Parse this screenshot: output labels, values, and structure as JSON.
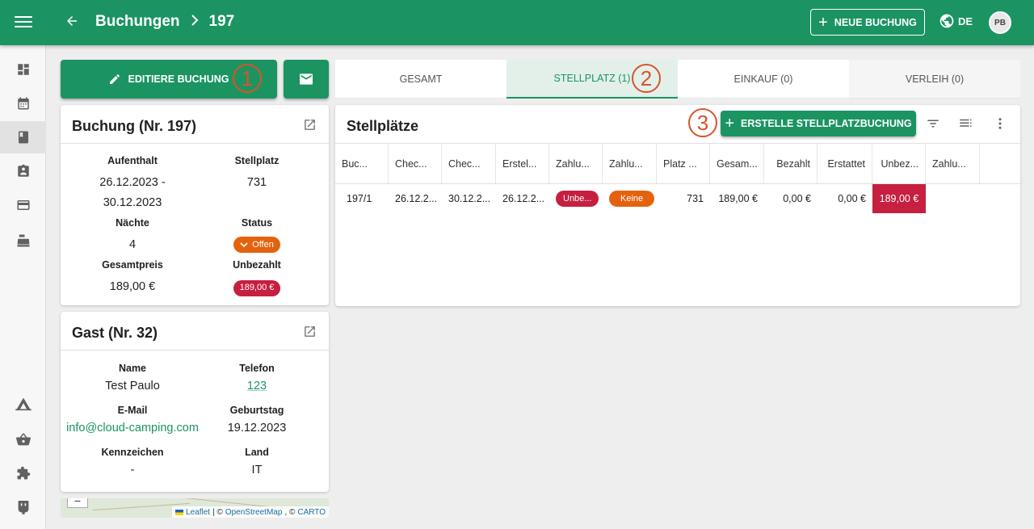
{
  "header": {
    "breadcrumb_parent": "Buchungen",
    "breadcrumb_current": "197",
    "new_booking_label": "NEUE BUCHUNG",
    "language": "DE",
    "avatar_initials": "PB"
  },
  "sidebar": {
    "items": [
      {
        "icon": "dashboard-icon"
      },
      {
        "icon": "calendar-icon"
      },
      {
        "icon": "book-icon",
        "active": true
      },
      {
        "icon": "contact-card-icon"
      },
      {
        "icon": "credit-card-icon"
      },
      {
        "icon": "cash-register-icon"
      },
      {
        "icon": "tent-icon"
      },
      {
        "icon": "basket-icon"
      },
      {
        "icon": "puzzle-icon"
      },
      {
        "icon": "plug-icon"
      }
    ]
  },
  "actions": {
    "edit_label": "EDITIERE BUCHUNG",
    "marker_1": "1",
    "marker_2": "2",
    "marker_3": "3"
  },
  "booking_card": {
    "title": "Buchung (Nr. 197)",
    "stay_label": "Aufenthalt",
    "stay_value_line1": "26.12.2023 -",
    "stay_value_line2": "30.12.2023",
    "pitch_label": "Stellplatz",
    "pitch_value": "731",
    "nights_label": "Nächte",
    "nights_value": "4",
    "status_label": "Status",
    "status_value": "Offen",
    "total_label": "Gesamtpreis",
    "total_value": "189,00 €",
    "unpaid_label": "Unbezahlt",
    "unpaid_value": "189,00 €"
  },
  "guest_card": {
    "title": "Gast (Nr. 32)",
    "name_label": "Name",
    "name_value": "Test Paulo",
    "phone_label": "Telefon",
    "phone_value": "123",
    "email_label": "E-Mail",
    "email_value": "info@cloud-camping.com",
    "birthday_label": "Geburtstag",
    "birthday_value": "19.12.2023",
    "plate_label": "Kennzeichen",
    "plate_value": "-",
    "country_label": "Land",
    "country_value": "IT"
  },
  "map": {
    "zoom_out": "−",
    "attr_leaflet": "Leaflet",
    "attr_sep1": "| ©",
    "attr_osm": "OpenStreetMap",
    "attr_sep2": ", ©",
    "attr_carto": "CARTO"
  },
  "tabs": [
    {
      "label": "GESAMT"
    },
    {
      "label": "STELLPLATZ (1)",
      "active": true
    },
    {
      "label": "EINKAUF (0)"
    },
    {
      "label": "VERLEIH (0)"
    }
  ],
  "pitches": {
    "title": "Stellplätze",
    "create_label": "ERSTELLE STELLPLATZBUCHUNG",
    "columns": [
      "Buc...",
      "Chec...",
      "Chec...",
      "Erstel...",
      "Zahlu...",
      "Zahlu...",
      "Platz ...",
      "Gesam...",
      "Bezahlt",
      "Erstattet",
      "Unbez...",
      "Zahlu..."
    ],
    "row": {
      "booking": "197/1",
      "checkin": "26.12.2...",
      "checkout": "30.12.2...",
      "created": "26.12.2...",
      "payment_status": "Unbe...",
      "payment_method": "Keine",
      "pitch": "731",
      "total": "189,00 €",
      "paid": "0,00 €",
      "refunded": "0,00 €",
      "unpaid": "189,00 €",
      "payment_extra": ""
    }
  },
  "colors": {
    "primary": "#1b9462",
    "orange": "#e4620f",
    "red": "#c61f3f",
    "marker": "#d9532b"
  }
}
